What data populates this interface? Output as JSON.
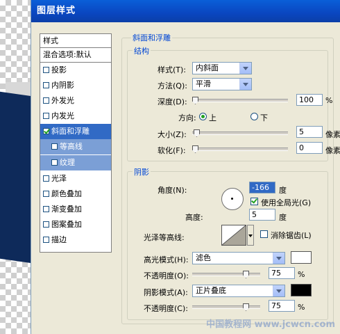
{
  "dialog": {
    "title": "图层样式"
  },
  "left": {
    "header": "样式",
    "blend": "混合选项:默认",
    "items": [
      {
        "label": "投影"
      },
      {
        "label": "内阴影"
      },
      {
        "label": "外发光"
      },
      {
        "label": "内发光"
      },
      {
        "label": "斜面和浮雕"
      },
      {
        "label": "等高线"
      },
      {
        "label": "纹理"
      },
      {
        "label": "光泽"
      },
      {
        "label": "颜色叠加"
      },
      {
        "label": "渐变叠加"
      },
      {
        "label": "图案叠加"
      },
      {
        "label": "描边"
      }
    ]
  },
  "bevel": {
    "group_title": "斜面和浮雕",
    "structure_title": "结构",
    "style_label": "样式(T):",
    "style_value": "内斜面",
    "method_label": "方法(Q):",
    "method_value": "平滑",
    "depth_label": "深度(D):",
    "depth_value": "100",
    "depth_unit": "%",
    "direction_label": "方向:",
    "dir_up": "上",
    "dir_down": "下",
    "size_label": "大小(Z):",
    "size_value": "5",
    "size_unit": "像素",
    "soften_label": "软化(F):",
    "soften_value": "0",
    "soften_unit": "像素"
  },
  "shading": {
    "title": "阴影",
    "angle_label": "角度(N):",
    "angle_value": "-166",
    "angle_unit": "度",
    "global_light_label": "使用全局光(G)",
    "altitude_label": "高度:",
    "altitude_value": "5",
    "altitude_unit": "度",
    "gloss_label": "光泽等高线:",
    "antialias_label": "消除锯齿(L)",
    "highlight_label": "高光模式(H):",
    "highlight_mode": "滤色",
    "highlight_color": "#ffffff",
    "opacity_label": "不透明度(O):",
    "highlight_opacity": "75",
    "opacity_unit": "%",
    "shadow_label": "阴影模式(A):",
    "shadow_mode": "正片叠底",
    "shadow_color": "#000000",
    "opacity2_label": "不透明度(C):",
    "shadow_opacity": "75",
    "opacity2_unit": "%"
  },
  "watermark": "中国教程网 www.jcwcn.com"
}
